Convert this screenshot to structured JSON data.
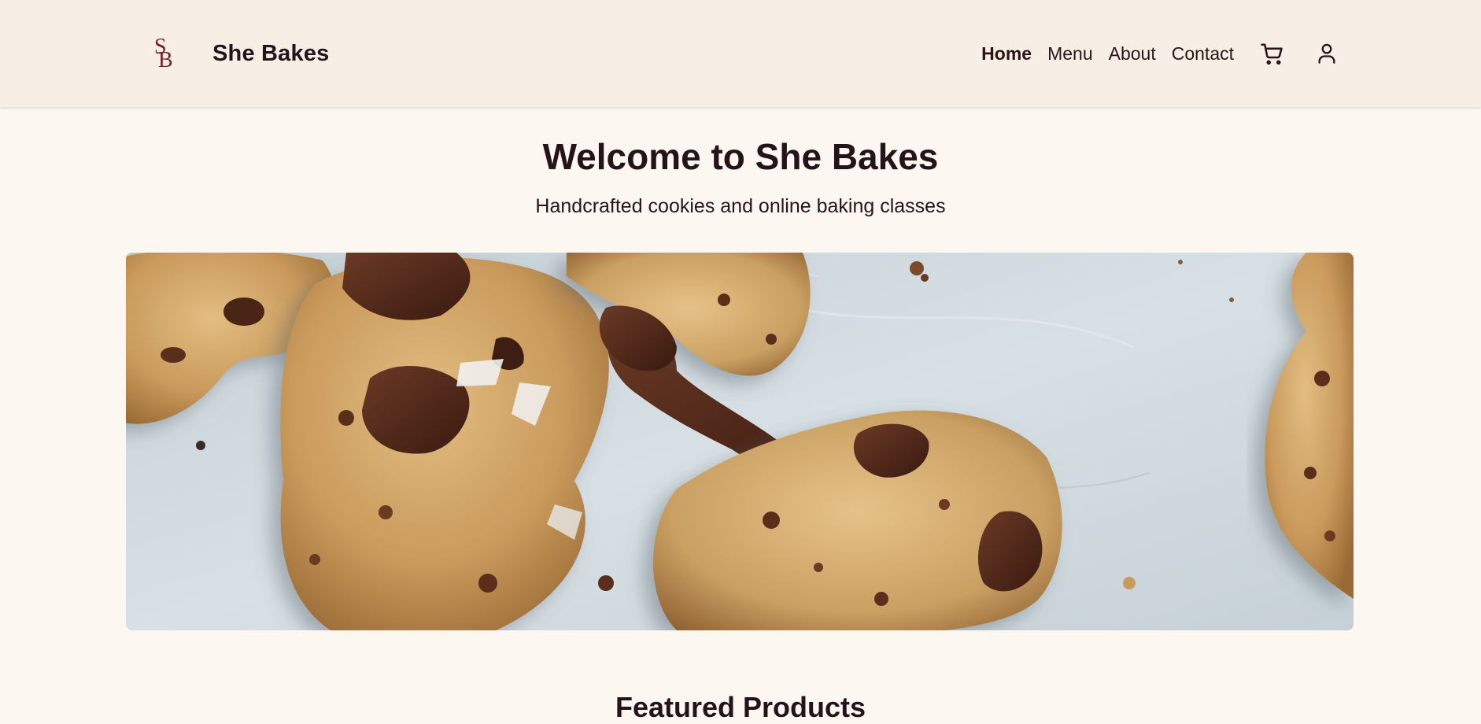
{
  "header": {
    "logo": {
      "top_letter": "S",
      "bottom_letter": "B",
      "color": "#7b1e2b"
    },
    "brand_name": "She Bakes",
    "nav": [
      {
        "label": "Home",
        "active": true
      },
      {
        "label": "Menu",
        "active": false
      },
      {
        "label": "About",
        "active": false
      },
      {
        "label": "Contact",
        "active": false
      }
    ],
    "icons": [
      "cart-icon",
      "user-icon"
    ]
  },
  "hero": {
    "title": "Welcome to She Bakes",
    "subtitle": "Handcrafted cookies and online baking classes",
    "image": "chocolate-chip-cookies-photo"
  },
  "featured": {
    "title": "Featured Products"
  },
  "colors": {
    "header_bg": "#f7efe6",
    "page_bg": "#fdf7f1",
    "text": "#25131a",
    "brand_accent": "#7b1e2b"
  }
}
